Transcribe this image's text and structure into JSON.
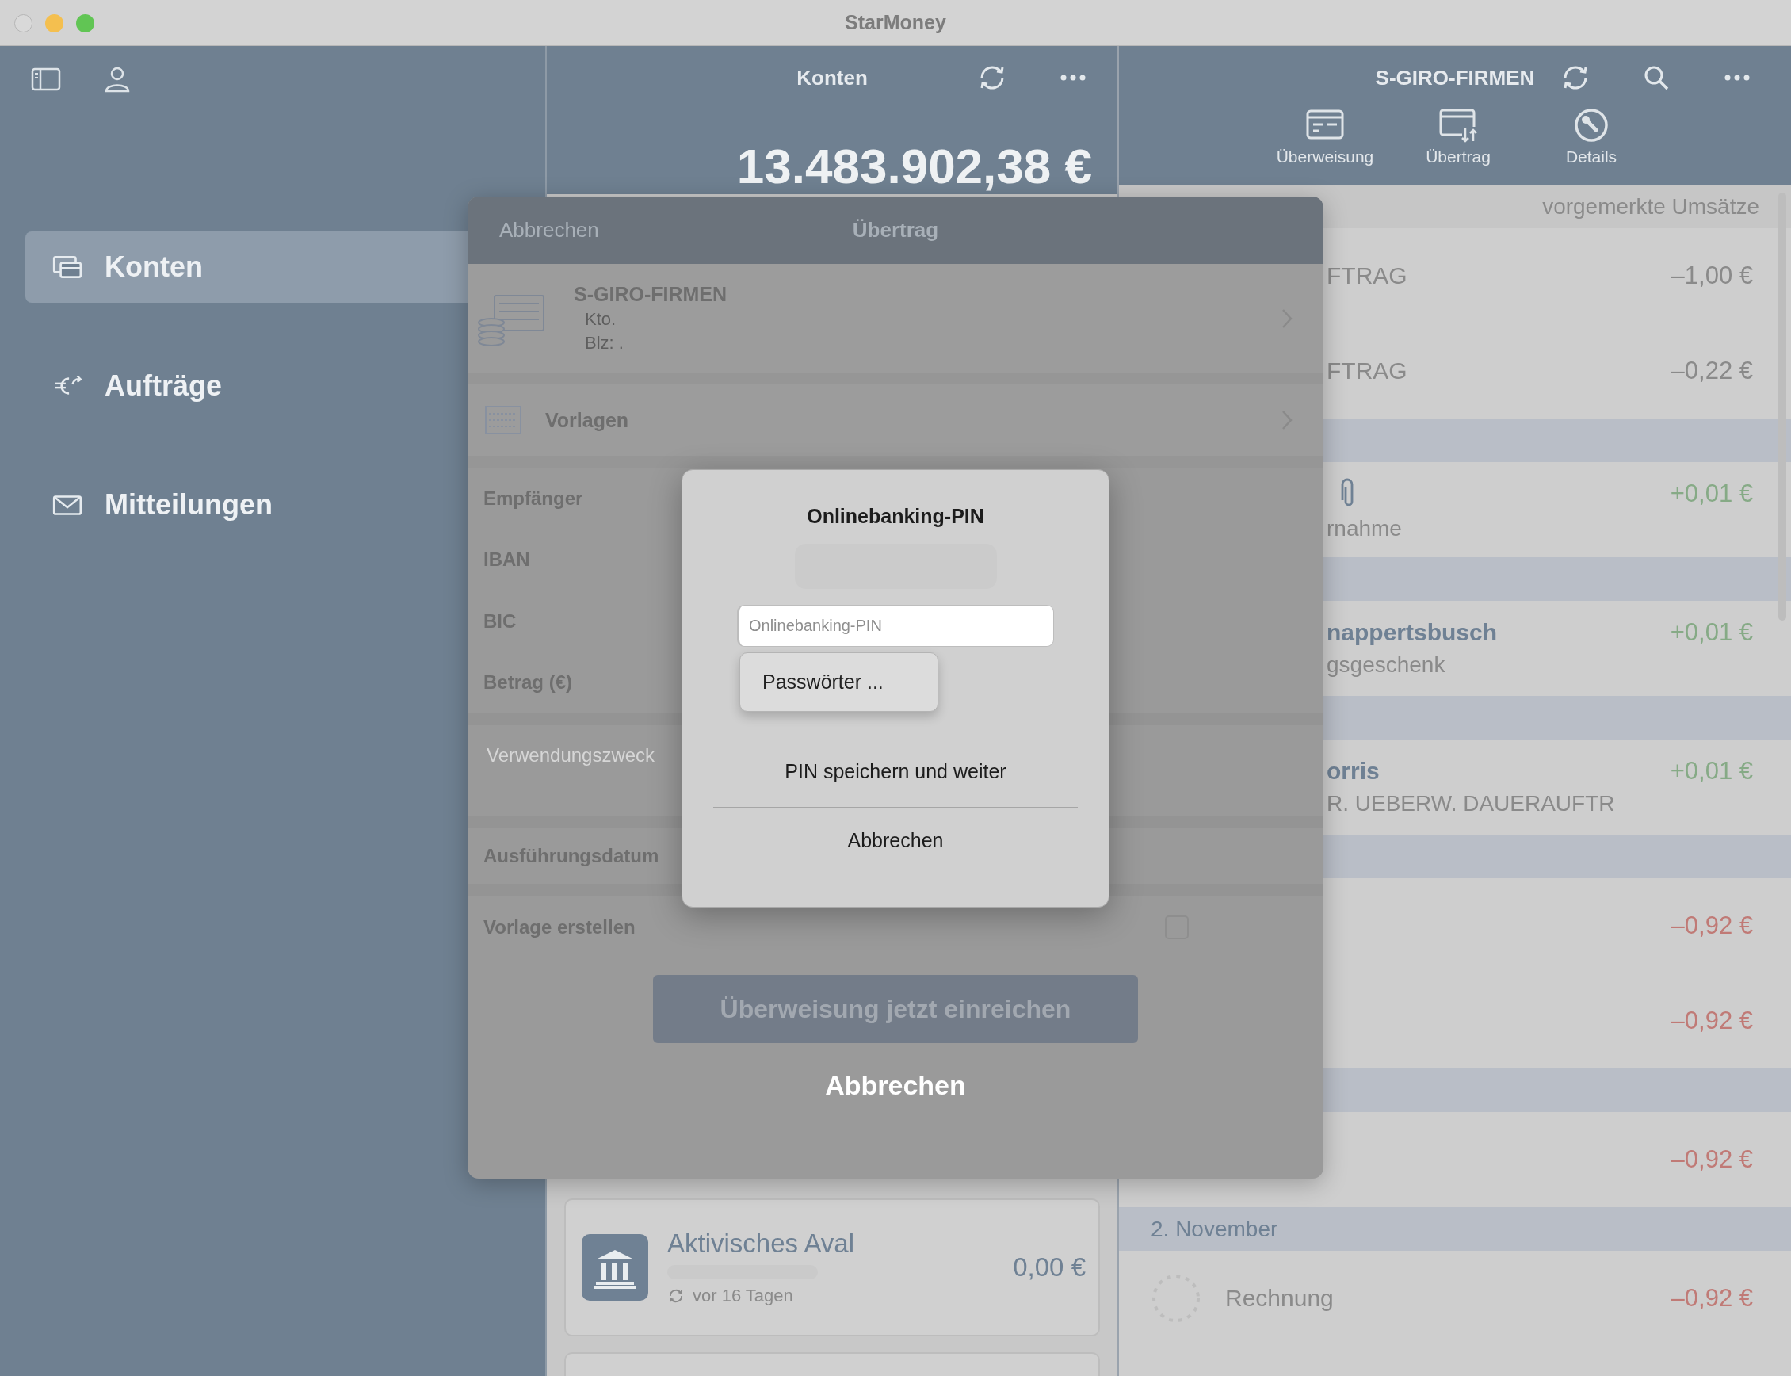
{
  "window": {
    "title": "StarMoney"
  },
  "sidebar": {
    "items": [
      {
        "label": "Konten",
        "selected": true
      },
      {
        "label": "Aufträge",
        "selected": false
      },
      {
        "label": "Mitteilungen",
        "selected": false
      }
    ]
  },
  "accounts_panel": {
    "title": "Konten",
    "total": "13.483.902,38 €",
    "cards": [
      {
        "name": "Aktivisches Aval",
        "balance": "0,00 €",
        "updated": "vor 16 Tagen"
      }
    ]
  },
  "account_panel": {
    "title": "S-GIRO-FIRMEN",
    "toolbar": [
      "Überweisung",
      "Übertrag",
      "Details"
    ],
    "section": "vorgemerkte Umsätze",
    "rows": [
      {
        "kind": "pending",
        "title": "FTRAG",
        "amount": "–1,00 €",
        "color": "#8a8a8a"
      },
      {
        "kind": "pending",
        "title": "FTRAG",
        "amount": "–0,22 €",
        "color": "#8a8a8a"
      },
      {
        "kind": "band"
      },
      {
        "kind": "booked",
        "attachment": true,
        "subtitle": "rnahme",
        "amount": "+0,01 €",
        "color": "#86aa86"
      },
      {
        "kind": "band"
      },
      {
        "kind": "booked",
        "title": "nappertsbusch",
        "subtitle": "gsgeschenk",
        "amount": "+0,01 €",
        "color": "#86aa86"
      },
      {
        "kind": "band"
      },
      {
        "kind": "booked",
        "title": "orris",
        "subtitle": "R. UEBERW. DAUERAUFTR",
        "amount": "+0,01 €",
        "color": "#86aa86"
      },
      {
        "kind": "band"
      },
      {
        "kind": "booked",
        "amount": "–0,92 €",
        "color": "#c07a76"
      },
      {
        "kind": "booked",
        "amount": "–0,92 €",
        "color": "#c07a76"
      },
      {
        "kind": "band"
      },
      {
        "kind": "booked",
        "amount": "–0,92 €",
        "color": "#c07a76"
      },
      {
        "kind": "band",
        "label": "2. November"
      },
      {
        "kind": "entry",
        "title": "Rechnung",
        "amount": "–0,92 €",
        "color": "#c07a76"
      }
    ]
  },
  "transfer_sheet": {
    "cancel": "Abbrechen",
    "title": "Übertrag",
    "account": {
      "name": "S-GIRO-FIRMEN",
      "lines": [
        "Kto.",
        "Blz: ."
      ]
    },
    "templates": "Vorlagen",
    "fields": [
      {
        "label": "Empfänger"
      },
      {
        "label": "IBAN"
      },
      {
        "label": "BIC"
      },
      {
        "label": "Betrag (€)"
      }
    ],
    "purpose_placeholder": "Verwendungszweck",
    "date_label": "Ausführungsdatum",
    "save_template": {
      "label": "Vorlage erstellen",
      "checked": false
    },
    "submit": {
      "label": "Überweisung jetzt einreichen",
      "disabled": true
    },
    "cancel_bottom": "Abbrechen"
  },
  "pin_dialog": {
    "title": "Onlinebanking-PIN",
    "pin_placeholder": "Onlinebanking-PIN",
    "autofill": "Passwörter ...",
    "actions": [
      "PIN speichern und weiter",
      "Abbrechen"
    ]
  }
}
